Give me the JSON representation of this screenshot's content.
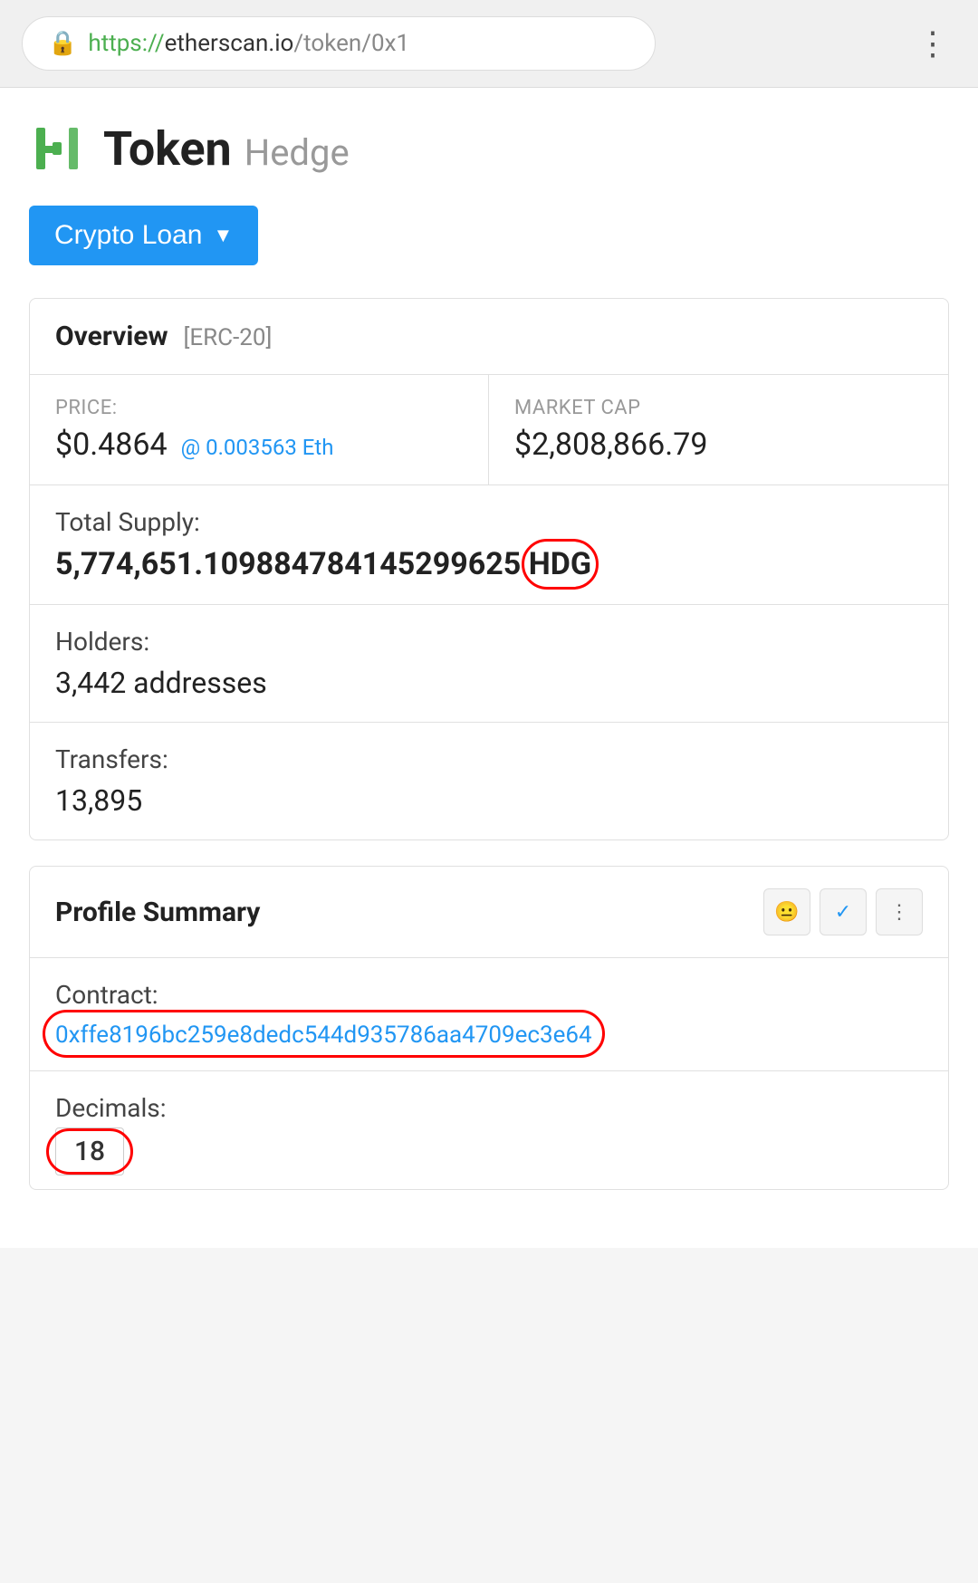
{
  "browser": {
    "url_protocol": "https://",
    "url_domain": "etherscan.io",
    "url_path": "/token/0x1",
    "url_display": "https://etherscan.io/token/0x1",
    "menu_icon": "⋮"
  },
  "token": {
    "name": "Token",
    "subtitle": "Hedge",
    "logo_alt": "Hedge Token Logo"
  },
  "crypto_loan_button": {
    "label": "Crypto Loan",
    "chevron": "▼"
  },
  "overview": {
    "title": "Overview",
    "badge": "[ERC-20]",
    "price_label": "PRICE:",
    "price_value": "$0.4864",
    "price_eth": "@ 0.003563 Eth",
    "market_cap_label": "MARKET CAP",
    "market_cap_value": "$2,808,866.79",
    "total_supply_label": "Total Supply:",
    "total_supply_value": "5,774,651.109884784145299625",
    "total_supply_symbol": "HDG",
    "holders_label": "Holders:",
    "holders_value": "3,442 addresses",
    "transfers_label": "Transfers:",
    "transfers_value": "13,895"
  },
  "profile_summary": {
    "title": "Profile Summary",
    "contract_label": "Contract:",
    "contract_address": "0xffe8196bc259e8dedc544d935786aa4709ec3e64",
    "decimals_label": "Decimals:",
    "decimals_value": "18",
    "action_face": "😐",
    "action_check": "✓",
    "action_more": "⋮"
  }
}
